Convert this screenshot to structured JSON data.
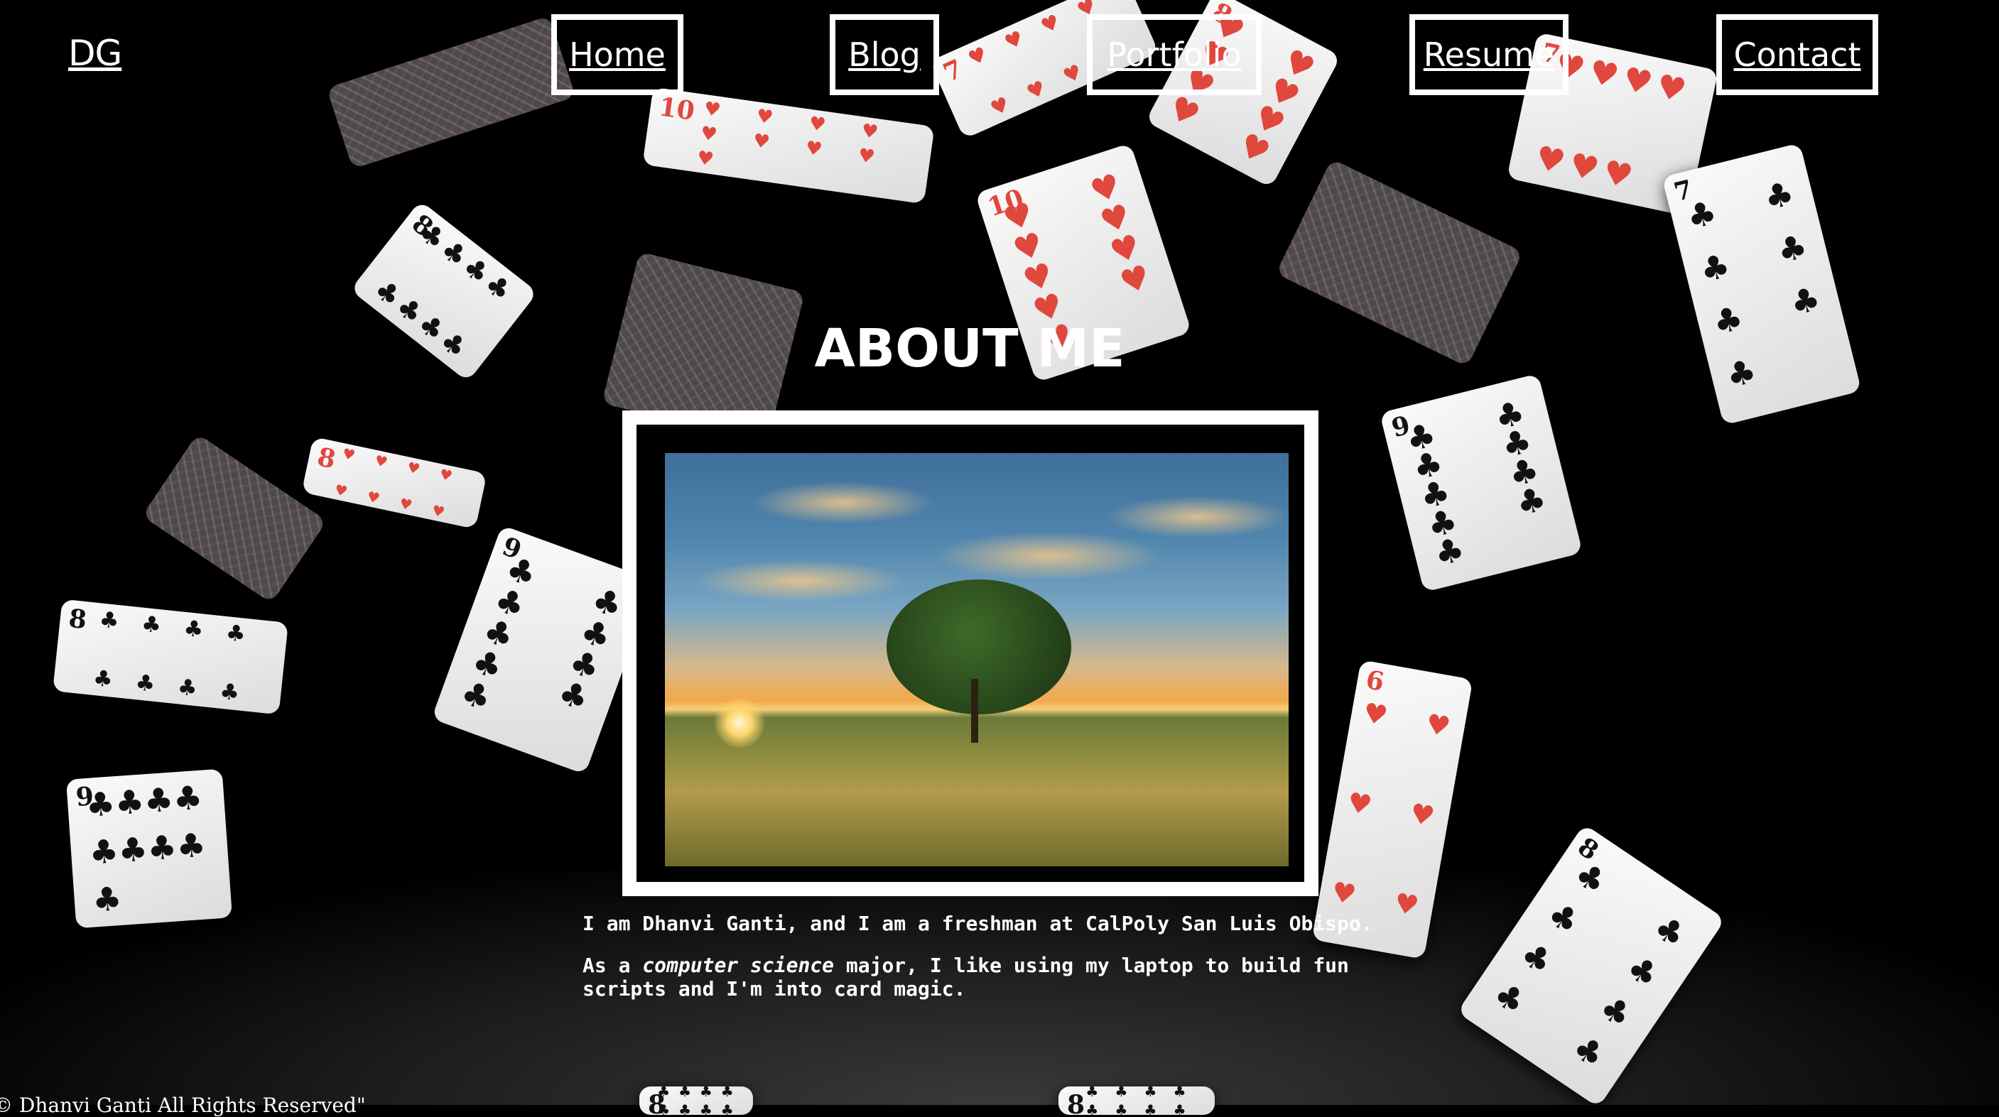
{
  "header": {
    "logo": "DG",
    "nav": [
      {
        "label": "Home"
      },
      {
        "label": "Blog"
      },
      {
        "label": "Portfolio"
      },
      {
        "label": "Resume"
      },
      {
        "label": "Contact"
      }
    ]
  },
  "main": {
    "title": "ABOUT ME",
    "bio": {
      "line1": "I am Dhanvi Ganti, and I am a freshman at CalPoly San Luis Obispo.",
      "line2_prefix": "As a ",
      "line2_emphasis": "computer science",
      "line2_suffix": " major, I like using my laptop to build fun scripts and I'm into card magic."
    }
  },
  "footer": {
    "text": "© Dhanvi Ganti All Rights Reserved\""
  },
  "colors": {
    "background": "#000000",
    "text": "#ffffff",
    "heart_red": "#e0473d"
  }
}
